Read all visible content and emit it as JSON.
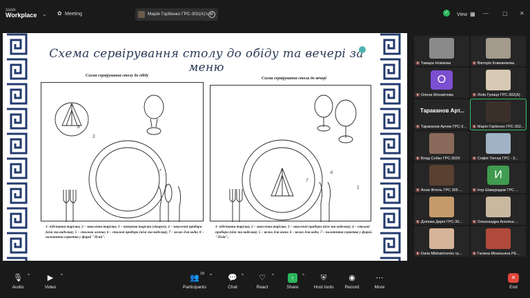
{
  "topbar": {
    "brand_small": "zoom",
    "brand_big": "Workplace",
    "meeting_label": "Meeting",
    "share_label": "Марія Горбенко ГРС-302(А)'s si",
    "view_label": "View"
  },
  "slide": {
    "title": "Схема сервірування столу до обіду та вечері за меню",
    "left_panel_title": "Схема сервірування столу до обіду",
    "right_panel_title": "Схема сервірування стола до вечері",
    "left_caption": "1- підставна тарілка; 2 – закусочна тарілка; 3 – паперова тарілка (ліворуч); 4 – закусочні прибори (ніж та виделка); 5 – столова ложка; 6 – столові прибори (ніж та виделка); 7 – келих для води; 8 – полотняна серветка у формі \"Лілія\".",
    "right_caption": "1- підставна тарілка; 2 – закусочна тарілка; 3 – закусочні прибори (ніж та виделка); 4 – столові прибори (ніж та виделка); 5 – келих для вина; 6 – келих для води; 7 – полотняна серветка у формі. \"Лілія\";",
    "left_numbers": [
      "8",
      "3",
      "7",
      "1",
      "2",
      "6",
      "4",
      "4",
      "5",
      "6"
    ],
    "right_numbers": [
      "7",
      "6",
      "5",
      "1",
      "2",
      "4",
      "3",
      "4",
      "3"
    ]
  },
  "gallery": [
    {
      "name": "Тамара Новікова",
      "kind": "video",
      "color": "#8a8a8a"
    },
    {
      "name": "Вікторія Кожевнікова",
      "kind": "video",
      "color": "#a39a8c"
    },
    {
      "name": "Олена Москвічова",
      "kind": "letter",
      "letter": "О",
      "color": "#7b4fd0"
    },
    {
      "name": "Лілія Гулиця ГРС-302(А)",
      "kind": "video",
      "color": "#d8c9b4"
    },
    {
      "name": "Тараканов Артем ГРС-30...",
      "kind": "bigname",
      "bigname": "Тараканов  Арт..."
    },
    {
      "name": "Марія Горбенко ГРС-302...",
      "kind": "video",
      "color": "#3b2f2a",
      "active": true
    },
    {
      "name": "Влад Собко ГРС-302б",
      "kind": "video",
      "color": "#8a6a5a"
    },
    {
      "name": "Софія Топчук ГРС - 3...",
      "kind": "video",
      "color": "#9fb3c4"
    },
    {
      "name": "Анна Фітель ГРС 305 ...",
      "kind": "video",
      "color": "#5a4030"
    },
    {
      "name": "Ігор Шамурадов ГРС ...",
      "kind": "letter",
      "letter": "И",
      "color": "#3f9b4f"
    },
    {
      "name": "Дніпева Дарія ГРС-30...",
      "kind": "video",
      "color": "#c49a6a"
    },
    {
      "name": "Олександра Анеліна ...",
      "kind": "video",
      "color": "#c8b8a0"
    },
    {
      "name": "Daria Mikhalchenko гр...",
      "kind": "video",
      "color": "#d6b49a"
    },
    {
      "name": "Галина Міхальніна РЕ...",
      "kind": "video",
      "color": "#b04a3a"
    }
  ],
  "toolbar": {
    "audio": "Audio",
    "video": "Video",
    "participants": "Participants",
    "participants_count": "18",
    "chat": "Chat",
    "react": "React",
    "share": "Share",
    "host_tools": "Host tools",
    "record": "Record",
    "more": "More",
    "end": "End"
  }
}
